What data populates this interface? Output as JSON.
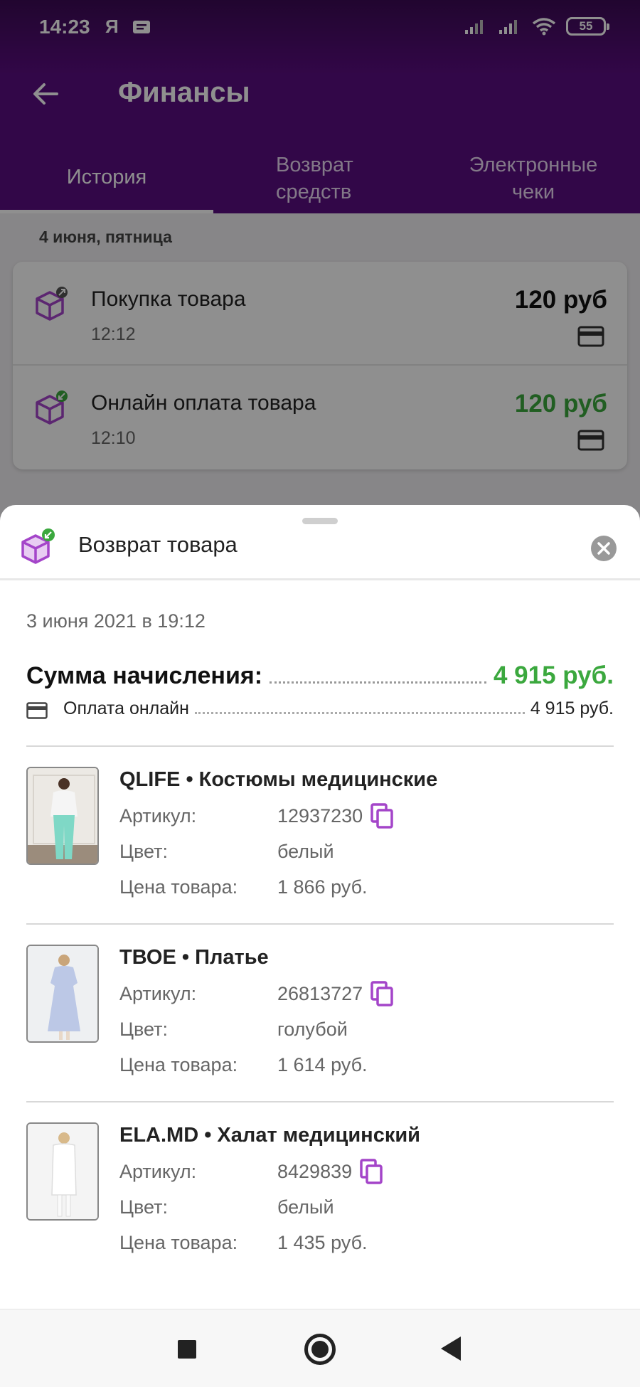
{
  "status_bar": {
    "time": "14:23",
    "ya": "Я",
    "battery": "55"
  },
  "app_bar": {
    "title": "Финансы"
  },
  "tabs": [
    {
      "label": "История"
    },
    {
      "label": "Возврат средств"
    },
    {
      "label": "Электронные чеки"
    }
  ],
  "history": {
    "date_label": "4 июня, пятница",
    "transactions": [
      {
        "title": "Покупка товара",
        "time": "12:12",
        "amount": "120 руб"
      },
      {
        "title": "Онлайн оплата товара",
        "time": "12:10",
        "amount": "120 руб"
      }
    ]
  },
  "sheet": {
    "title": "Возврат товара",
    "date": "3 июня 2021 в 19:12",
    "sum_label": "Сумма начисления:",
    "sum_value": "4 915 руб.",
    "payment_label": "Оплата онлайн",
    "payment_value": "4 915 руб.",
    "field_labels": {
      "article": "Артикул:",
      "color": "Цвет:",
      "price": "Цена товара:"
    },
    "products": [
      {
        "title": "QLIFE • Костюмы медицинские",
        "article": "12937230",
        "color": "белый",
        "price": "1 866 руб."
      },
      {
        "title": "ТВОЕ • Платье",
        "article": "26813727",
        "color": "голубой",
        "price": "1 614 руб."
      },
      {
        "title": "ELA.MD • Халат медицинский",
        "article": "8429839",
        "color": "белый",
        "price": "1 435 руб."
      }
    ]
  },
  "colors": {
    "brand": "#5a0d80",
    "accent_purple": "#a445c9",
    "positive": "#3ba83e"
  }
}
